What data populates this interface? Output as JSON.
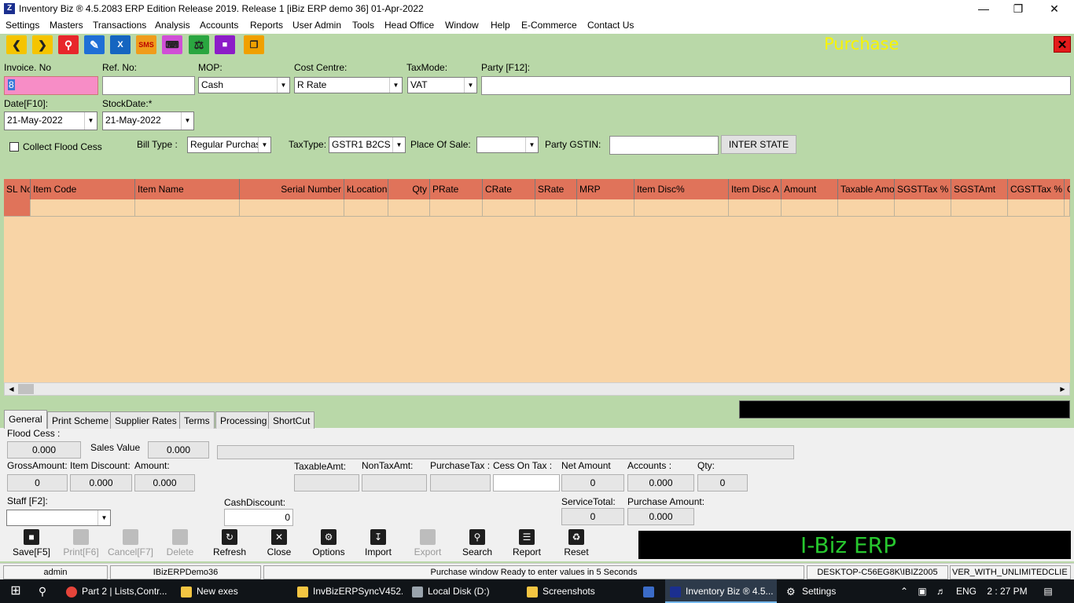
{
  "window": {
    "title": "Inventory Biz ® 4.5.2083 ERP Edition Release 2019. Release 1  [iBiz ERP demo 36] 01-Apr-2022",
    "app_icon": "Z",
    "minimize": "—",
    "restore": "❐",
    "close": "✕"
  },
  "menu": [
    "Settings",
    "Masters",
    "Transactions",
    "Analysis",
    "Accounts",
    "Reports",
    "User Admin",
    "Tools",
    "Head Office",
    "Window",
    "Help",
    "E-Commerce",
    "Contact Us"
  ],
  "toolbar": {
    "sms_label": "SMS",
    "form_title": "Purchase",
    "close_glyph": "✕",
    "colors": {
      "prev": "#f5c400",
      "next": "#f5c400",
      "search": "#e8262b",
      "edit": "#1f6fd6",
      "excel": "#1565c0",
      "sms": "#f09c1b",
      "keyboard": "#d04fd6",
      "auction": "#2aa640",
      "lock": "#8c1cc8",
      "copy": "#f0a000"
    }
  },
  "form": {
    "invoice_label": "Invoice. No",
    "invoice_value": "8",
    "ref_label": "Ref. No:",
    "ref_value": "",
    "mop_label": "MOP:",
    "mop_value": "Cash",
    "cost_centre_label": "Cost Centre:",
    "cost_centre_value": "R Rate",
    "taxmode_label": "TaxMode:",
    "taxmode_value": "VAT",
    "party_label": "Party [F12]:",
    "party_value": "",
    "date_label": "Date[F10]:",
    "date_value": "21-May-2022",
    "stockdate_label": "StockDate:*",
    "stockdate_value": "21-May-2022",
    "flood_cess_label": "Collect Flood Cess",
    "bill_type_label": "Bill Type :",
    "bill_type_value": "Regular Purchas",
    "tax_type_label": "TaxType:",
    "tax_type_value": "GSTR1 B2CS",
    "place_of_sale_label": "Place Of Sale:",
    "place_of_sale_value": "",
    "party_gstin_label": "Party GSTIN:",
    "party_gstin_value": "",
    "inter_state_label": "INTER STATE"
  },
  "grid": {
    "columns": [
      "SL No",
      "Item Code",
      "Item Name",
      "Serial Number",
      "kLocation",
      "Qty",
      "PRate",
      "CRate",
      "SRate",
      "MRP",
      "Item Disc%",
      "Item Disc A",
      "Amount",
      "Taxable Amo",
      "SGSTTax %",
      "SGSTAmt",
      "CGSTTax %",
      "C"
    ]
  },
  "tabs": [
    "General",
    "Print Scheme",
    "Supplier Rates",
    "Terms",
    "Processing",
    "ShortCut"
  ],
  "totals": {
    "flood_cess_label": "Flood Cess :",
    "flood_cess_value": "0.000",
    "sales_value_label": "Sales Value",
    "sales_value_value": "0.000",
    "gross_amount_label": "GrossAmount:",
    "gross_amount_value": "0",
    "item_discount_label": "Item Discount:",
    "item_discount_value": "0.000",
    "amount_label": "Amount:",
    "amount_value": "0.000",
    "taxable_amt_label": "TaxableAmt:",
    "taxable_amt_value": "",
    "nontax_amt_label": "NonTaxAmt:",
    "nontax_amt_value": "",
    "purchase_tax_label": "PurchaseTax :",
    "purchase_tax_value": "",
    "cess_on_tax_label": "Cess On Tax :",
    "cess_on_tax_value": "",
    "net_amount_label": "Net Amount",
    "net_amount_value": "0",
    "accounts_label": "Accounts :",
    "accounts_value": "0.000",
    "qty_label": "Qty:",
    "qty_value": "0",
    "staff_label": "Staff [F2]:",
    "staff_value": "",
    "cash_discount_label": "CashDiscount:",
    "cash_discount_value": "0",
    "service_total_label": "ServiceTotal:",
    "service_total_value": "0",
    "purchase_amount_label": "Purchase Amount:",
    "purchase_amount_value": "0.000"
  },
  "actions": {
    "save": "Save[F5]",
    "print": "Print[F6]",
    "cancel": "Cancel[F7]",
    "delete": "Delete",
    "refresh": "Refresh",
    "close": "Close",
    "options": "Options",
    "import": "Import",
    "export": "Export",
    "search": "Search",
    "report": "Report",
    "reset": "Reset"
  },
  "brand": "I-Biz ERP",
  "status": {
    "user": "admin",
    "database": "IBizERPDemo36",
    "message": "Purchase window Ready to enter values in 5 Seconds",
    "server": "DESKTOP-C56EG8K\\IBIZ2005",
    "license": "VER_WITH_UNLIMITEDCLIE"
  },
  "taskbar": {
    "items": [
      "Part 2 | Lists,Contr...",
      "New exes",
      "InvBizERPSyncV452...",
      "Local Disk (D:)",
      "Screenshots",
      "",
      "Inventory Biz ® 4.5...",
      "Settings"
    ],
    "lang": "ENG",
    "time": "2 : 27 PM"
  }
}
